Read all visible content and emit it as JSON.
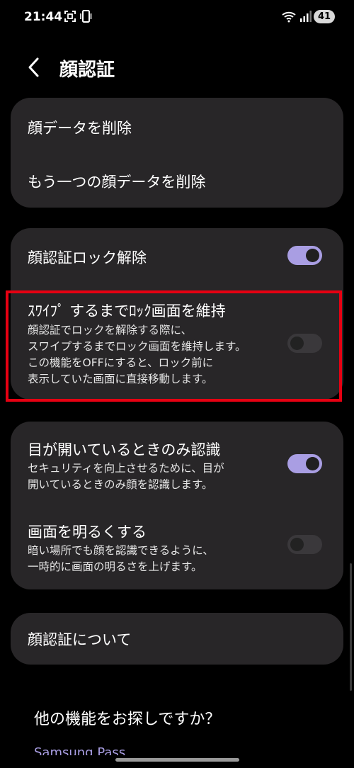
{
  "status_bar": {
    "time": "21:44",
    "battery": "41"
  },
  "header": {
    "title": "顔認証"
  },
  "face_data_card": {
    "items": [
      {
        "label": "顔データを削除"
      },
      {
        "label": "もう一つの顔データを削除"
      }
    ]
  },
  "unlock_card": {
    "face_unlock": {
      "label": "顔認証ロック解除",
      "enabled": true
    },
    "stay_on_lock": {
      "label": "ｽﾜｲﾌﾟ するまでﾛｯｸ画面を維持",
      "description": [
        "顔認証でロックを解除する際に、",
        "スワイプするまでロック画面を維持します。",
        "この機能をOFFにすると、ロック前に",
        "表示していた画面に直接移動します。"
      ],
      "enabled": false
    }
  },
  "options_card": {
    "eyes_open": {
      "label": "目が開いているときのみ認識",
      "description": [
        "セキュリティを向上させるために、目が",
        "開いているときのみ顔を認識します。"
      ],
      "enabled": true
    },
    "brighten": {
      "label": "画面を明るくする",
      "description": [
        "暗い場所でも顔を認識できるように、",
        "一時的に画面の明るさを上げます。"
      ],
      "enabled": false
    }
  },
  "about_card": {
    "label": "顔認証について"
  },
  "looking_for_more": {
    "title": "他の機能をお探しですか？",
    "link": "Samsung Pass"
  },
  "colors": {
    "background": "#000000",
    "card": "#282628",
    "toggle_on": "#a99ee3",
    "toggle_off": "#3a383b",
    "highlight_border": "#e60012"
  },
  "icons": [
    "qr-scan-icon",
    "vibrate-icon",
    "wifi-icon",
    "signal-icon",
    "back-chevron-icon"
  ]
}
